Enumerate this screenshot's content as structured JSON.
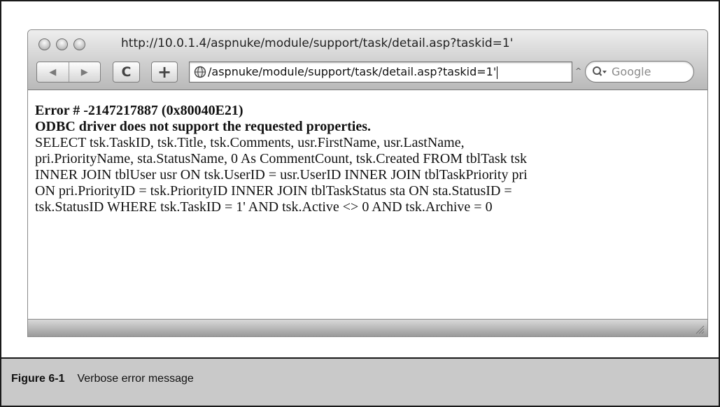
{
  "browser": {
    "title": "http://10.0.1.4/aspnuke/module/support/task/detail.asp?taskid=1'",
    "url": "/aspnuke/module/support/task/detail.asp?taskid=1'",
    "search_placeholder": "Google",
    "reload_symbol": "C",
    "add_symbol": "+",
    "back_symbol": "◀",
    "forward_symbol": "▶",
    "snapback_symbol": "^"
  },
  "page": {
    "error_line": "Error # -2147217887 (0x80040E21)",
    "message_line": "ODBC driver does not support the requested properties.",
    "sql_lines": [
      "SELECT tsk.TaskID, tsk.Title, tsk.Comments, usr.FirstName, usr.LastName,",
      "pri.PriorityName, sta.StatusName, 0 As CommentCount, tsk.Created FROM tblTask tsk",
      "INNER JOIN tblUser usr ON tsk.UserID = usr.UserID INNER JOIN tblTaskPriority pri",
      "ON pri.PriorityID = tsk.PriorityID INNER JOIN tblTaskStatus sta ON sta.StatusID =",
      "tsk.StatusID WHERE tsk.TaskID = 1' AND tsk.Active <> 0 AND tsk.Archive = 0"
    ]
  },
  "caption": {
    "label": "Figure 6-1",
    "text": "Verbose error message"
  }
}
